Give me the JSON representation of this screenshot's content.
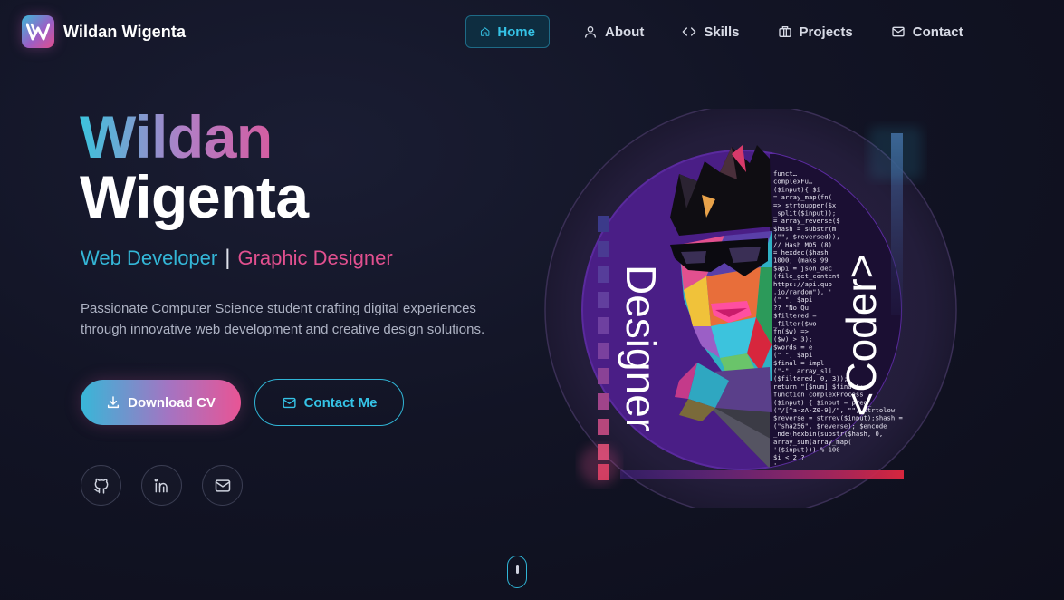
{
  "nav": {
    "brand": "Wildan Wigenta",
    "logo_letter": "W",
    "items": [
      {
        "label": "Home",
        "icon": "home-icon",
        "active": true
      },
      {
        "label": "About",
        "icon": "user-icon",
        "active": false
      },
      {
        "label": "Skills",
        "icon": "code-icon",
        "active": false
      },
      {
        "label": "Projects",
        "icon": "briefcase-icon",
        "active": false
      },
      {
        "label": "Contact",
        "icon": "mail-icon",
        "active": false
      }
    ]
  },
  "hero": {
    "first_name": "Wildan",
    "last_name": "Wigenta",
    "role1": "Web Developer",
    "separator": "|",
    "role2": "Graphic Designer",
    "description": "Passionate Computer Science student crafting digital experiences through innovative web development and creative design solutions.",
    "download_cv": "Download CV",
    "contact_me": "Contact Me",
    "socials": [
      "github-icon",
      "linkedin-icon",
      "mail-icon"
    ]
  },
  "art": {
    "designer": "Designer",
    "coder": "<Coder>",
    "code_lines": [
      "funct…",
      "complexFu…",
      "($input){  $i",
      " = array_map(fn(",
      "=> strtoupper($x",
      "_split($input));",
      " = array_reverse($",
      " $hash = substr(m",
      "(\"\", $reversed)),",
      "// Hash MD5 (8)",
      " = hexdec($hash",
      "1000;  (maks 99",
      " $api = json_dec",
      "(file_get_content",
      "https://api.quo",
      ".io/random\"), '",
      "(\" \", $api",
      " ?? \"No Qu",
      "$filtered =",
      "_filter($wo",
      "fn($w) =>",
      "($w) > 3);",
      "$words = e",
      "(\" \", $api",
      "$final = impl",
      "(\"-\", array_sli",
      "($filtered, 0, 3));",
      "return \"[$num] $final\";",
      "function complexProcess",
      "($input) {   $input = preg_",
      "(\"/[^a-zA-Z0-9]/\", \"\", strtolow",
      "$reverse = strrev($input);$hash =",
      "(\"sha256\", $reverse);    $encode",
      "  _nde(hexbin(substr($hash, 0,",
      "   array_sum(array_map(",
      "        '($input))) % 100",
      "           $i < 2 ?",
      "              '"
    ]
  },
  "colors": {
    "accent_cyan": "#35c3e6",
    "accent_pink": "#e2508f",
    "accent_purple": "#9b5fc6",
    "bg": "#121425"
  }
}
